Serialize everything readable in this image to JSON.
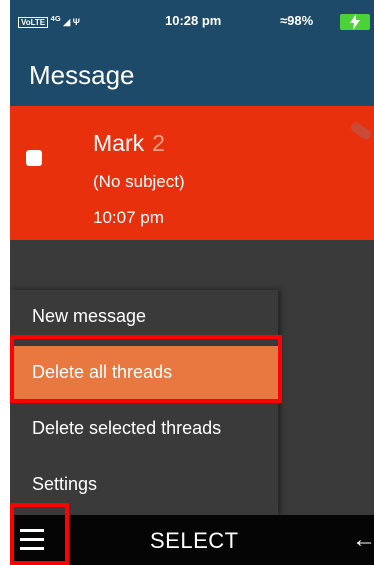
{
  "status_bar": {
    "volte": "VoLTE",
    "network": "4G",
    "usb": "Ψ",
    "time": "10:28 pm",
    "battery_pct": "98%",
    "battery_level": 0.98
  },
  "header": {
    "title": "Message"
  },
  "thread": {
    "name": "Mark",
    "count": "2",
    "subject": "(No subject)",
    "time": "10:07 pm"
  },
  "menu": {
    "items": [
      {
        "label": "New message"
      },
      {
        "label": "Delete all threads"
      },
      {
        "label": "Delete selected threads"
      },
      {
        "label": "Settings"
      }
    ],
    "selected_index": 1
  },
  "bottom_bar": {
    "select_label": "SELECT",
    "back_glyph": "←"
  },
  "colors": {
    "header_bg": "#1d4a68",
    "thread_bg": "#e8300c",
    "menu_selected": "#e87840",
    "highlight": "#ff0000"
  }
}
